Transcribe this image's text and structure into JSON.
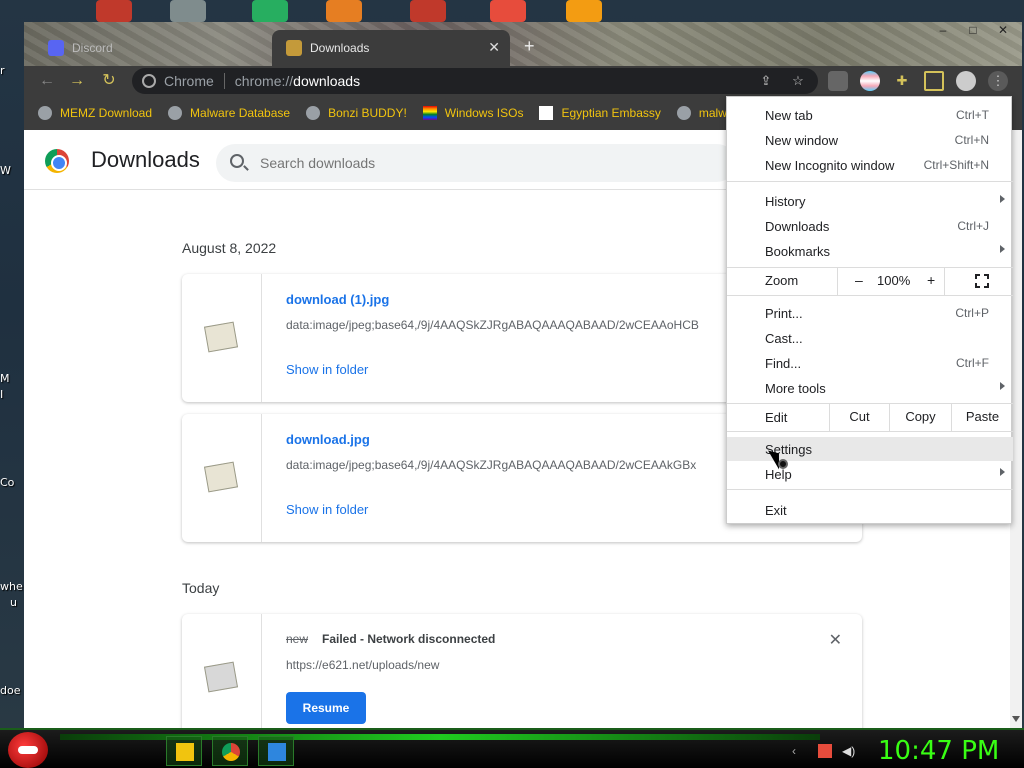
{
  "desktop": {
    "left_labels": [
      "r",
      "W",
      "M",
      "I",
      "Co",
      "whe",
      "u",
      "doe"
    ]
  },
  "window": {
    "tabs": [
      {
        "label": "Discord",
        "active": false
      },
      {
        "label": "Downloads",
        "active": true
      }
    ],
    "controls": {
      "minimize": "–",
      "maximize": "□",
      "close": "✕"
    }
  },
  "toolbar": {
    "back_icon": "arrow-left-icon",
    "forward_icon": "arrow-right-icon",
    "reload_icon": "reload-icon",
    "chip_label": "Chrome",
    "url_scheme": "chrome://",
    "url_host": "downloads"
  },
  "bookmarks": [
    {
      "label": "MEMZ Download",
      "icon": "globe-icon"
    },
    {
      "label": "Malware Database",
      "icon": "globe-icon"
    },
    {
      "label": "Bonzi BUDDY!",
      "icon": "globe-icon"
    },
    {
      "label": "Windows ISOs",
      "icon": "rainbow-flag-icon"
    },
    {
      "label": "Egyptian Embassy",
      "icon": "wix-icon"
    },
    {
      "label": "malw",
      "icon": "globe-icon"
    }
  ],
  "downloads_page": {
    "title": "Downloads",
    "search_placeholder": "Search downloads",
    "sections": [
      {
        "date": "August 8, 2022",
        "items": [
          {
            "filename": "download (1).jpg",
            "url": "data:image/jpeg;base64,/9j/4AAQSkZJRgABAQAAAQABAAD/2wCEAAoHCB",
            "action": "Show in folder"
          },
          {
            "filename": "download.jpg",
            "url": "data:image/jpeg;base64,/9j/4AAQSkZJRgABAQAAAQABAAD/2wCEAAkGBx",
            "action": "Show in folder"
          }
        ]
      },
      {
        "date": "Today",
        "items": [
          {
            "filename": "new",
            "status": "Failed - Network disconnected",
            "url": "https://e621.net/uploads/new",
            "action": "Resume"
          }
        ]
      }
    ]
  },
  "menu": {
    "items": [
      {
        "label": "New tab",
        "shortcut": "Ctrl+T"
      },
      {
        "label": "New window",
        "shortcut": "Ctrl+N"
      },
      {
        "label": "New Incognito window",
        "shortcut": "Ctrl+Shift+N"
      },
      {
        "label": "History",
        "submenu": true
      },
      {
        "label": "Downloads",
        "shortcut": "Ctrl+J"
      },
      {
        "label": "Bookmarks",
        "submenu": true
      },
      {
        "label": "Print...",
        "shortcut": "Ctrl+P"
      },
      {
        "label": "Cast..."
      },
      {
        "label": "Find...",
        "shortcut": "Ctrl+F"
      },
      {
        "label": "More tools",
        "submenu": true
      },
      {
        "label": "Settings",
        "hover": true
      },
      {
        "label": "Help",
        "submenu": true
      },
      {
        "label": "Exit"
      }
    ],
    "zoom": {
      "label": "Zoom",
      "minus": "–",
      "value": "100%",
      "plus": "+"
    },
    "edit": {
      "label": "Edit",
      "cut": "Cut",
      "copy": "Copy",
      "paste": "Paste"
    }
  },
  "taskbar": {
    "clock": "10:47 PM"
  },
  "colors": {
    "accent_blue": "#1a73e8",
    "bookmark_text": "#f1c40f",
    "clock_green": "#39ff14"
  }
}
